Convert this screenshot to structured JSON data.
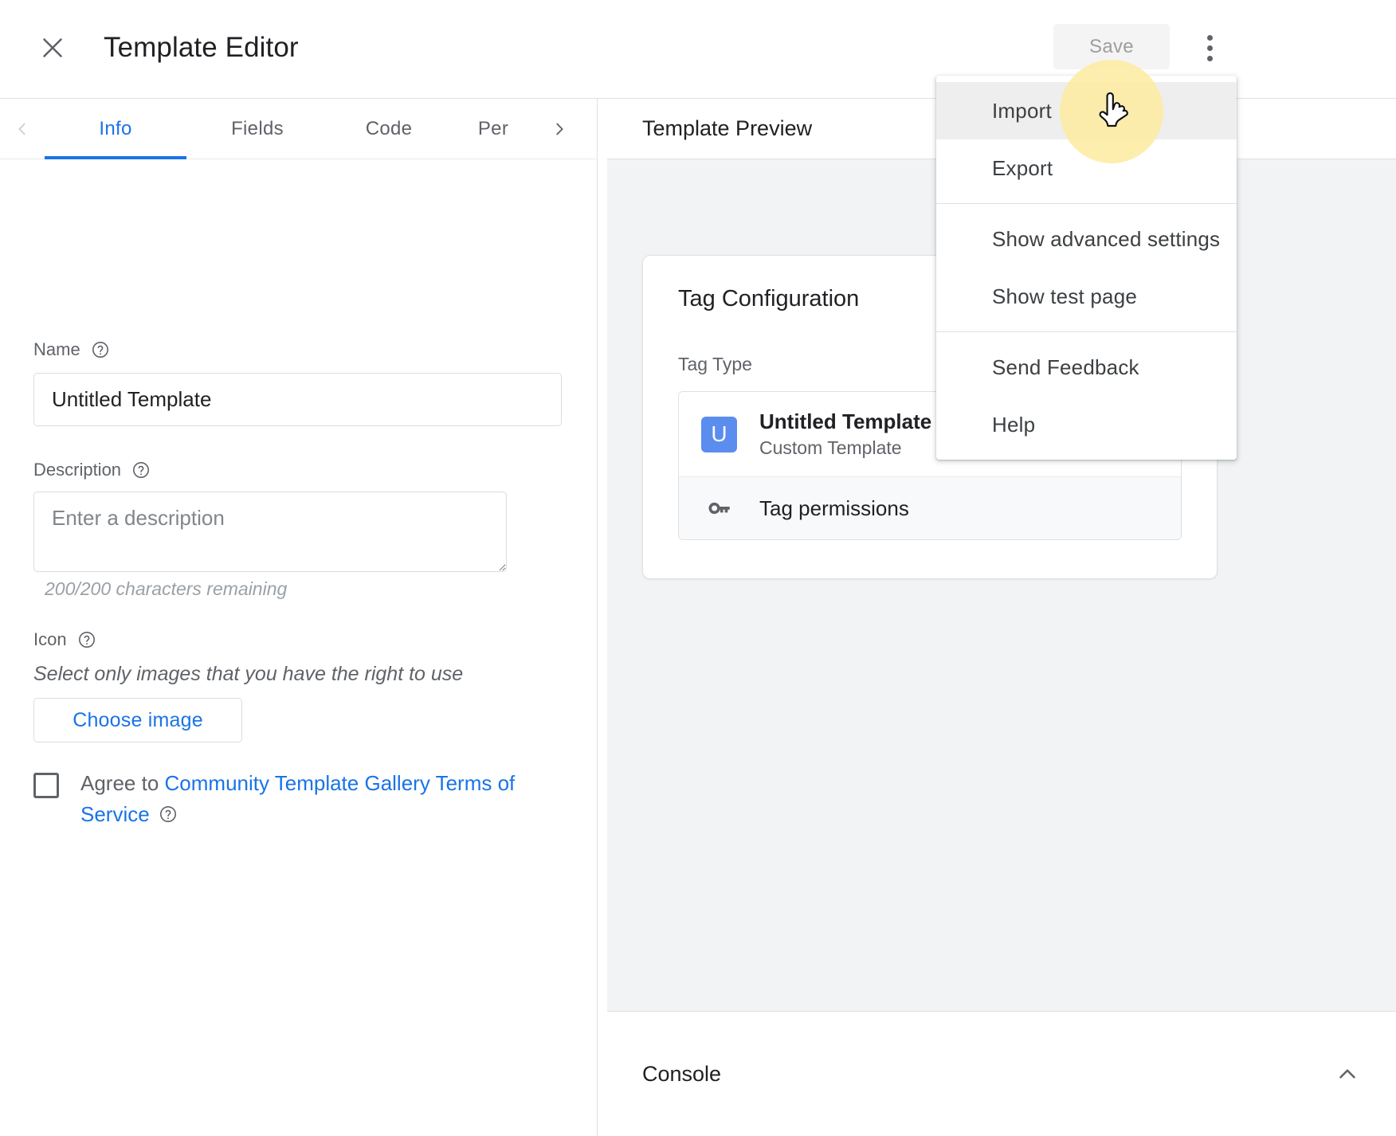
{
  "topbar": {
    "close_icon": "close-icon",
    "title": "Template Editor",
    "save_label": "Save",
    "kebab_icon": "more-vert-icon"
  },
  "tabs": {
    "prev_icon": "chevron-left-icon",
    "next_icon": "chevron-right-icon",
    "items": [
      {
        "label": "Info",
        "active": true
      },
      {
        "label": "Fields",
        "active": false
      },
      {
        "label": "Code",
        "active": false
      },
      {
        "label": "Per",
        "active": false
      }
    ]
  },
  "form": {
    "name_label": "Name",
    "name_value": "Untitled Template",
    "name_help_icon": "help-circle-icon",
    "description_label": "Description",
    "description_value": "",
    "description_placeholder": "Enter a description",
    "description_help_icon": "help-circle-icon",
    "char_count": "200/200 characters remaining",
    "icon_label": "Icon",
    "icon_help_icon": "help-circle-icon",
    "icon_hint": "Select only images that you have the right to use",
    "choose_image_label": "Choose image",
    "agree_prefix": "Agree to ",
    "agree_link": "Community Template Gallery Terms of Service",
    "agree_help_icon": "help-circle-icon",
    "agree_checked": false
  },
  "preview": {
    "title": "Template Preview",
    "card": {
      "title": "Tag Configuration",
      "tag_type_label": "Tag Type",
      "tag_avatar_letter": "U",
      "tag_name": "Untitled Template",
      "tag_subtitle": "Custom Template",
      "permissions_label": "Tag permissions",
      "permissions_icon": "key-icon"
    }
  },
  "console": {
    "title": "Console",
    "collapse_icon": "chevron-up-icon"
  },
  "menu": {
    "items": [
      {
        "label": "Import",
        "highlight": true
      },
      {
        "label": "Export",
        "highlight": false
      },
      {
        "label": "Show advanced settings",
        "highlight": false
      },
      {
        "label": "Show test page",
        "highlight": false
      },
      {
        "label": "Send Feedback",
        "highlight": false
      },
      {
        "label": "Help",
        "highlight": false
      }
    ]
  },
  "colors": {
    "accent": "#1a73e8",
    "avatar": "#5b8def",
    "halo": "#fdeba0",
    "panel_bg": "#f1f3f4"
  }
}
